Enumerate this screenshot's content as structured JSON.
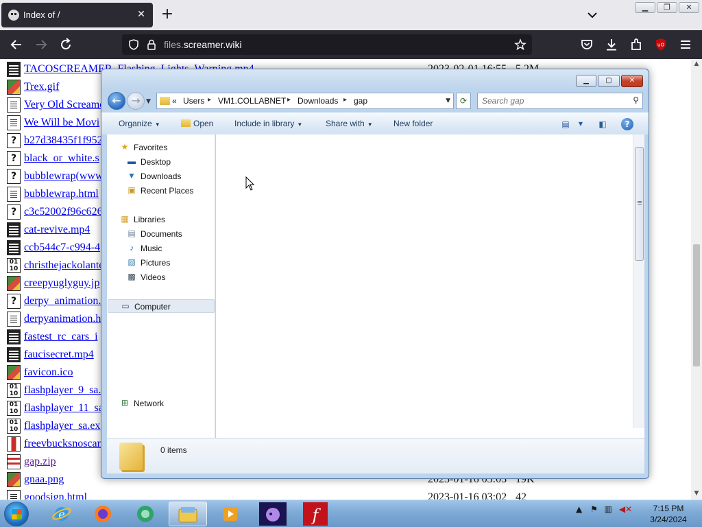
{
  "browser": {
    "tab_title": "Index of /",
    "tab_close": "✕",
    "new_tab": "+",
    "url_domain": "files.",
    "url_host": "screamer.wiki",
    "icons": [
      "back-arrow-icon",
      "forward-arrow-icon",
      "reload-icon",
      "shield-icon",
      "lock-icon",
      "bookmark-star-icon",
      "pocket-icon",
      "download-icon",
      "extensions-icon",
      "ublock-icon",
      "hamburger-menu-icon"
    ]
  },
  "listing": [
    {
      "name": "TACOSCREAMER_Flashing_Lights_Warning.mp4",
      "date": "2023-02-01 16:55",
      "size": "5.2M",
      "icon": "vid"
    },
    {
      "name": "Trex.gif",
      "icon": "img"
    },
    {
      "name": "Very Old Screamer.html",
      "icon": "txt"
    },
    {
      "name": "We Will be Movi",
      "icon": "txt"
    },
    {
      "name": "b27d38435f1f952",
      "icon": "unk"
    },
    {
      "name": "black_or_white.s",
      "icon": "unk"
    },
    {
      "name": "bubblewrap(www",
      "icon": "unk"
    },
    {
      "name": "bubblewrap.html",
      "icon": "txt"
    },
    {
      "name": "c3c52002f96c626",
      "icon": "unk"
    },
    {
      "name": "cat-revive.mp4",
      "icon": "vid"
    },
    {
      "name": "ccb544c7-c994-4",
      "icon": "vid"
    },
    {
      "name": "christhejackolante",
      "icon": "bin"
    },
    {
      "name": "creepyuglyguy.jp",
      "icon": "img"
    },
    {
      "name": "derpy_animation.",
      "icon": "unk"
    },
    {
      "name": "derpyanimation.h",
      "icon": "txt"
    },
    {
      "name": "fastest_rc_cars_i",
      "icon": "vid"
    },
    {
      "name": "faucisecret.mp4",
      "icon": "vid"
    },
    {
      "name": "favicon.ico",
      "icon": "img"
    },
    {
      "name": "flashplayer_9_sa.",
      "icon": "bin"
    },
    {
      "name": "flashplayer_11_sa",
      "icon": "bin"
    },
    {
      "name": "flashplayer_sa.ex",
      "icon": "bin"
    },
    {
      "name": "freevbucksnoscan",
      "icon": "exe"
    },
    {
      "name": "gap.zip",
      "icon": "zip",
      "visited": true
    },
    {
      "name": "gnaa.png",
      "date": "2023-01-16 03:03",
      "size": "19K",
      "icon": "img"
    },
    {
      "name": "goodsign.html",
      "date": "2023-01-16 03:02",
      "size": "42",
      "icon": "txt"
    }
  ],
  "explorer": {
    "breadcrumb": [
      "«",
      "Users",
      "VM1.COLLABNET",
      "Downloads",
      "gap"
    ],
    "search_placeholder": "Search gap",
    "commands": {
      "organize": "Organize",
      "open": "Open",
      "include": "Include in library",
      "share": "Share with",
      "new_folder": "New folder"
    },
    "nav": {
      "favorites": "Favorites",
      "desktop": "Desktop",
      "downloads": "Downloads",
      "recent": "Recent Places",
      "libraries": "Libraries",
      "documents": "Documents",
      "music": "Music",
      "pictures": "Pictures",
      "videos": "Videos",
      "computer": "Computer",
      "network": "Network"
    },
    "status_count": "0 items"
  },
  "taskbar": {
    "time": "7:15 PM",
    "date": "3/24/2024",
    "items": [
      "internet-explorer",
      "firefox",
      "app-green-circle",
      "windows-explorer",
      "media-player",
      "pony-app",
      "flash-player"
    ]
  }
}
